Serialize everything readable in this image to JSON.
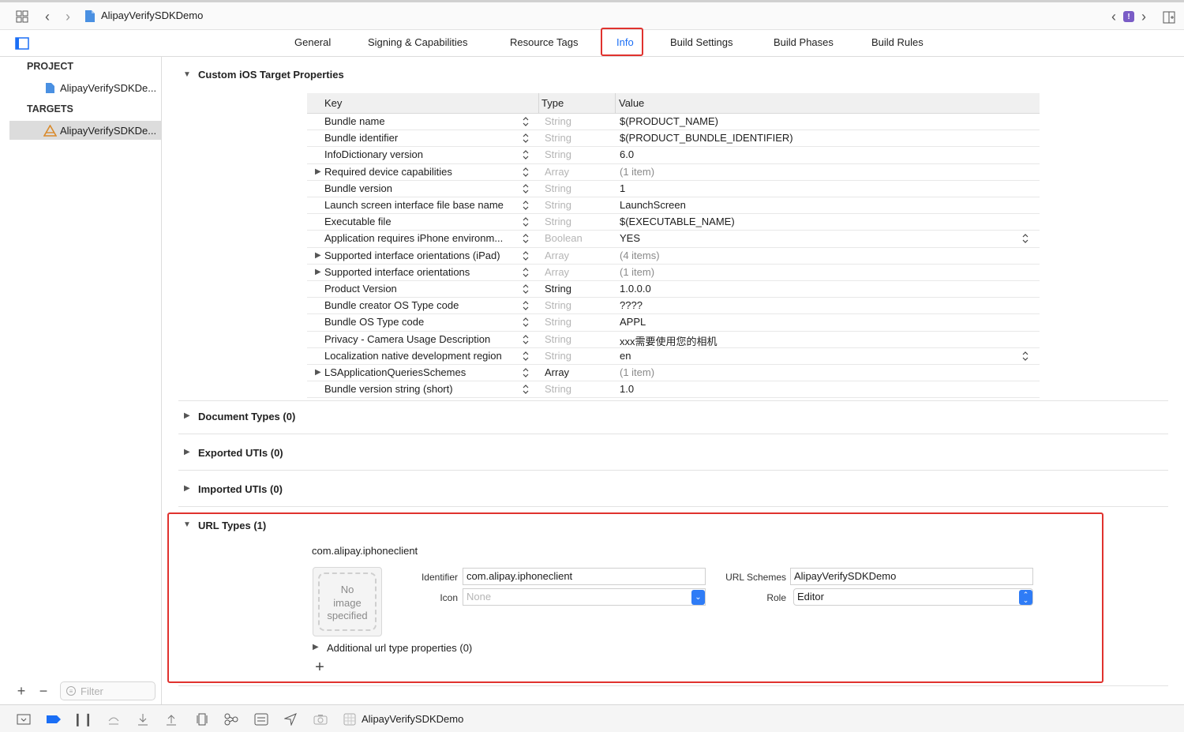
{
  "window": {
    "title": "AlipayVerifySDKDemo",
    "warning_badge": "!"
  },
  "tabs": [
    {
      "label": "General"
    },
    {
      "label": "Signing & Capabilities"
    },
    {
      "label": "Resource Tags"
    },
    {
      "label": "Info"
    },
    {
      "label": "Build Settings"
    },
    {
      "label": "Build Phases"
    },
    {
      "label": "Build Rules"
    }
  ],
  "sidebar": {
    "project_header": "PROJECT",
    "project_item": "AlipayVerifySDKDe...",
    "targets_header": "TARGETS",
    "target_item": "AlipayVerifySDKDe...",
    "filter_placeholder": "Filter"
  },
  "sections": {
    "custom_props": "Custom iOS Target Properties",
    "document_types": "Document Types (0)",
    "exported_utis": "Exported UTIs (0)",
    "imported_utis": "Imported UTIs (0)",
    "url_types": "URL Types (1)"
  },
  "table": {
    "headers": {
      "key": "Key",
      "type": "Type",
      "value": "Value"
    },
    "rows": [
      {
        "key": "Bundle name",
        "type": "String",
        "value": "$(PRODUCT_NAME)"
      },
      {
        "key": "Bundle identifier",
        "type": "String",
        "value": "$(PRODUCT_BUNDLE_IDENTIFIER)"
      },
      {
        "key": "InfoDictionary version",
        "type": "String",
        "value": "6.0"
      },
      {
        "key": "Required device capabilities",
        "type": "Array",
        "value": "(1 item)"
      },
      {
        "key": "Bundle version",
        "type": "String",
        "value": "1"
      },
      {
        "key": "Launch screen interface file base name",
        "type": "String",
        "value": "LaunchScreen"
      },
      {
        "key": "Executable file",
        "type": "String",
        "value": "$(EXECUTABLE_NAME)"
      },
      {
        "key": "Application requires iPhone environm...",
        "type": "Boolean",
        "value": "YES"
      },
      {
        "key": "Supported interface orientations (iPad)",
        "type": "Array",
        "value": "(4 items)"
      },
      {
        "key": "Supported interface orientations",
        "type": "Array",
        "value": "(1 item)"
      },
      {
        "key": "Product Version",
        "type": "String",
        "value": "1.0.0.0"
      },
      {
        "key": "Bundle creator OS Type code",
        "type": "String",
        "value": "????"
      },
      {
        "key": "Bundle OS Type code",
        "type": "String",
        "value": "APPL"
      },
      {
        "key": "Privacy - Camera Usage Description",
        "type": "String",
        "value": "xxx需要使用您的相机"
      },
      {
        "key": "Localization native development region",
        "type": "String",
        "value": "en"
      },
      {
        "key": "LSApplicationQueriesSchemes",
        "type": "Array",
        "value": "(1 item)"
      },
      {
        "key": "Bundle version string (short)",
        "type": "String",
        "value": "1.0"
      }
    ]
  },
  "url_type": {
    "name": "com.alipay.iphoneclient",
    "image_placeholder": [
      "No",
      "image",
      "specified"
    ],
    "identifier_label": "Identifier",
    "identifier_value": "com.alipay.iphoneclient",
    "icon_label": "Icon",
    "icon_placeholder": "None",
    "url_schemes_label": "URL Schemes",
    "url_schemes_value": "AlipayVerifySDKDemo",
    "role_label": "Role",
    "role_value": "Editor",
    "additional_props": "Additional url type properties (0)",
    "add_symbol": "+"
  },
  "bottombar": {
    "scheme_label": "AlipayVerifySDKDemo"
  },
  "colors": {
    "accent": "#2f7cf6",
    "highlight": "#e0322e"
  }
}
